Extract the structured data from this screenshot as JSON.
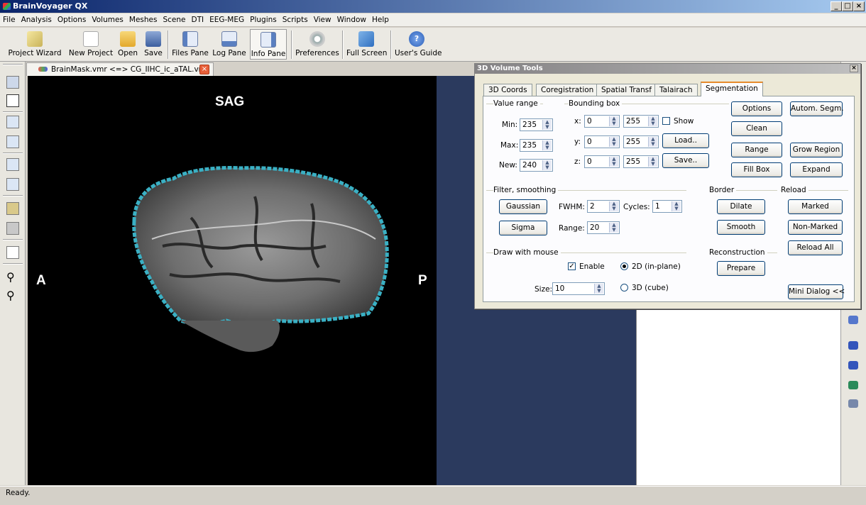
{
  "window": {
    "title": "BrainVoyager QX",
    "min": "_",
    "max": "□",
    "close": "×"
  },
  "menu": [
    "File",
    "Analysis",
    "Options",
    "Volumes",
    "Meshes",
    "Scene",
    "DTI",
    "EEG-MEG",
    "Plugins",
    "Scripts",
    "View",
    "Window",
    "Help"
  ],
  "toolbar": {
    "project_wizard": "Project Wizard",
    "new_project": "New Project",
    "open": "Open",
    "save": "Save",
    "files_pane": "Files Pane",
    "log_pane": "Log Pane",
    "info_pane": "Info Pane",
    "preferences": "Preferences",
    "full_screen": "Full Screen",
    "users_guide": "User's Guide"
  },
  "doc_tab": {
    "label": "BrainMask.vmr  <=>  CG_IIHC_ic_aTAL.vmr"
  },
  "viewer": {
    "view_label": "SAG",
    "left_label": "A",
    "right_label": "P"
  },
  "dialog": {
    "title": "3D Volume Tools",
    "tabs": [
      "3D Coords",
      "Coregistration",
      "Spatial Transf",
      "Talairach",
      "Segmentation"
    ],
    "selected_tab": "Segmentation",
    "value_range": {
      "label": "Value range",
      "min_label": "Min:",
      "min": "235",
      "max_label": "Max:",
      "max": "235",
      "new_label": "New:",
      "new": "240"
    },
    "bounding_box": {
      "label": "Bounding box",
      "x_label": "x:",
      "x_from": "0",
      "x_to": "255",
      "y_label": "y:",
      "y_from": "0",
      "y_to": "255",
      "z_label": "z:",
      "z_from": "0",
      "z_to": "255",
      "show_label": "Show",
      "load": "Load..",
      "save": "Save.."
    },
    "buttons": {
      "options": "Options",
      "autom_segm": "Autom. Segm.",
      "clean": "Clean",
      "range": "Range",
      "grow_region": "Grow Region",
      "fill_box": "Fill Box",
      "expand": "Expand"
    },
    "filter": {
      "label": "Filter, smoothing",
      "gaussian": "Gaussian",
      "sigma": "Sigma",
      "fwhm_label": "FWHM:",
      "fwhm": "2",
      "cycles_label": "Cycles:",
      "cycles": "1",
      "range_label": "Range:",
      "range": "20"
    },
    "border": {
      "label": "Border",
      "dilate": "Dilate",
      "smooth": "Smooth"
    },
    "reload": {
      "label": "Reload",
      "marked": "Marked",
      "non_marked": "Non-Marked",
      "reload_all": "Reload All"
    },
    "draw": {
      "label": "Draw with mouse",
      "enable": "Enable",
      "mode_2d": "2D (in-plane)",
      "mode_3d": "3D (cube)",
      "size_label": "Size:",
      "size": "10"
    },
    "reconstruction": {
      "label": "Reconstruction",
      "prepare": "Prepare"
    },
    "mini_dialog": "Mini Dialog <<"
  },
  "status": {
    "text": "Ready."
  }
}
